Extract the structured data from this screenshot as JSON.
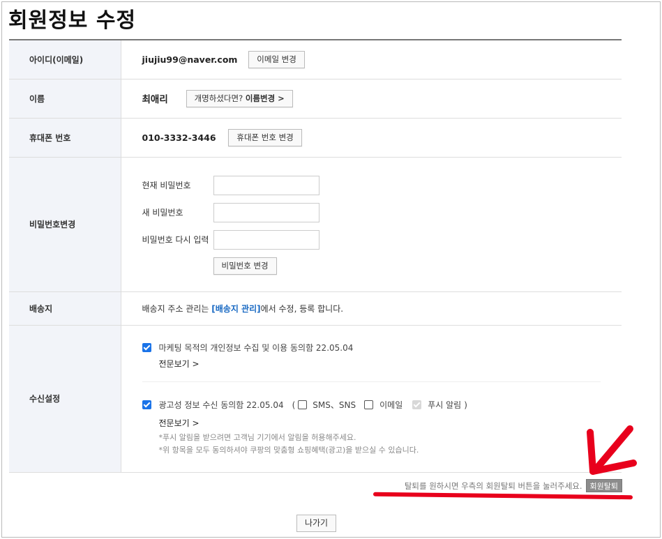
{
  "page_title": "회원정보 수정",
  "rows": {
    "email": {
      "label": "아이디(이메일)",
      "value": "jiujiu99@naver.com",
      "button": "이메일 변경"
    },
    "name": {
      "label": "이름",
      "value": "최애리",
      "button_prefix": "개명하셨다면? ",
      "button_bold": "이름변경 >"
    },
    "phone": {
      "label": "휴대폰 번호",
      "value": "010-3332-3446",
      "button": "휴대폰 번호 변경"
    },
    "password": {
      "label": "비밀번호변경",
      "current_label": "현재 비밀번호",
      "new_label": "새 비밀번호",
      "confirm_label": "비밀번호 다시 입력",
      "button": "비밀번호 변경"
    },
    "shipping": {
      "label": "배송지",
      "text_before": "배송지 주소 관리는 ",
      "link": "[배송지 관리]",
      "text_after": "에서 수정, 등록 합니다."
    },
    "notifications": {
      "label": "수신설정",
      "marketing": {
        "text": "마케팅 목적의 개인정보 수집 및 이용 동의함 22.05.04",
        "checked": true,
        "detail": "전문보기 >"
      },
      "ads": {
        "text": "광고성 정보 수신 동의함 22.05.04",
        "checked": true,
        "open_paren": "(",
        "sms": "SMS、SNS",
        "email": "이메일",
        "push": "푸시 알림",
        "close_paren": ")",
        "detail": "전문보기 >",
        "note1": "*푸시 알림을 받으려면 고객님 기기에서 알림을 허용해주세요.",
        "note2": "*위 항목을 모두 동의하셔야 쿠팡의 맞춤형 쇼핑혜택(광고)을 받으실 수 있습니다."
      }
    }
  },
  "withdraw": {
    "text": "탈퇴를 원하시면 우측의 회원탈퇴 버튼을 눌러주세요.",
    "button": "회원탈퇴"
  },
  "exit_button": "나가기",
  "colors": {
    "accent_blue": "#1a73e8",
    "annotation_red": "#e8001c",
    "header_bg": "#f2f4f9"
  }
}
